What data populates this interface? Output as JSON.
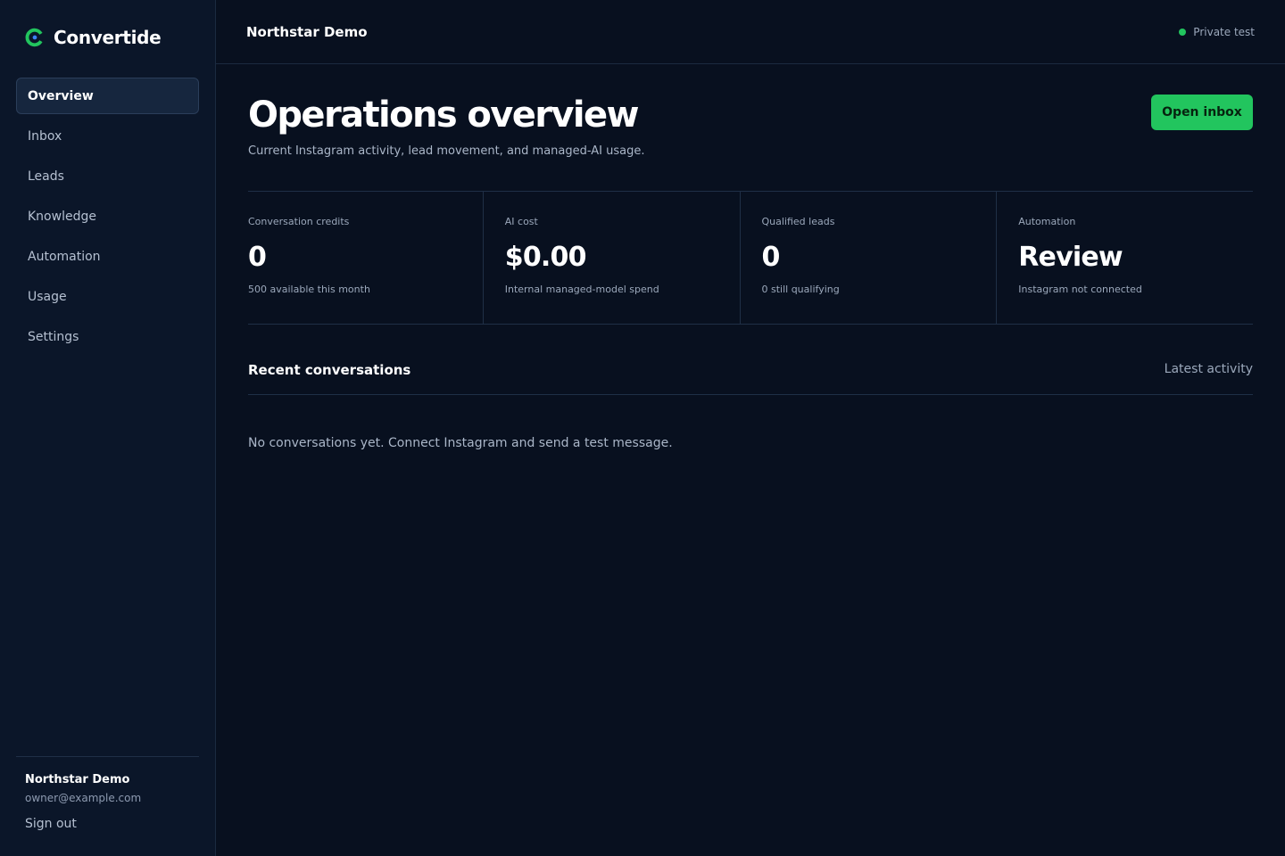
{
  "brand": {
    "name": "Convertide",
    "accent": "#22c55e"
  },
  "sidebar": {
    "items": [
      {
        "label": "Overview",
        "active": true
      },
      {
        "label": "Inbox",
        "active": false
      },
      {
        "label": "Leads",
        "active": false
      },
      {
        "label": "Knowledge",
        "active": false
      },
      {
        "label": "Automation",
        "active": false
      },
      {
        "label": "Usage",
        "active": false
      },
      {
        "label": "Settings",
        "active": false
      }
    ],
    "footer": {
      "org_name": "Northstar Demo",
      "email": "owner@example.com",
      "sign_out_label": "Sign out"
    }
  },
  "topbar": {
    "workspace_name": "Northstar Demo",
    "env_label": "Private test",
    "env_status_color": "#22c55e"
  },
  "page": {
    "title": "Operations overview",
    "subtitle": "Current Instagram activity, lead movement, and managed-AI usage.",
    "primary_action_label": "Open inbox"
  },
  "stats": [
    {
      "label": "Conversation credits",
      "value": "0",
      "sub": "500 available this month"
    },
    {
      "label": "AI cost",
      "value": "$0.00",
      "sub": "Internal managed-model spend"
    },
    {
      "label": "Qualified leads",
      "value": "0",
      "sub": "0 still qualifying"
    },
    {
      "label": "Automation",
      "value": "Review",
      "sub": "Instagram not connected"
    }
  ],
  "recent": {
    "title": "Recent conversations",
    "meta": "Latest activity",
    "empty_text": "No conversations yet. Connect Instagram and send a test message."
  }
}
